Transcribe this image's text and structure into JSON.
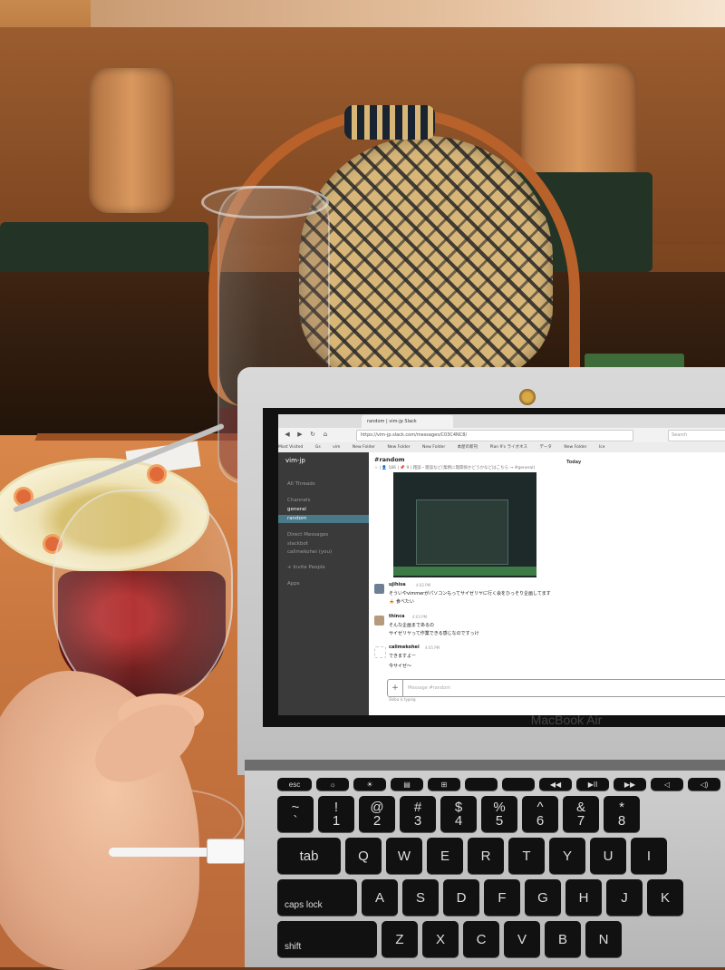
{
  "browser": {
    "tab_title": "random | vim-jp Slack",
    "url": "https://vim-jp.slack.com/messages/C03C4NC8/",
    "search_placeholder": "Search",
    "bookmarks": [
      "Most Visited",
      "Gs",
      "vim",
      "New Folder",
      "New Folder",
      "New Folder",
      "本屋の新刊",
      "Plan 9's ライオネス",
      "データ",
      "New Folder",
      "Ice"
    ]
  },
  "slack": {
    "team": "vim-jp",
    "sidebar": {
      "all_threads": "All Threads",
      "channels_label": "Channels",
      "channels": [
        "general",
        "random"
      ],
      "dm_label": "Direct Messages",
      "dms": [
        "slackbot",
        "calimekohei (you)"
      ],
      "invite": "+ Invite People",
      "apps": "Apps"
    },
    "channel": "#random",
    "topic": "☆ | 👤 186 | 📌 9 | 雑談・雑談など(業務に無関係かどうかなどはこちら → #general)",
    "date_divider": "Today",
    "messages": [
      {
        "user": "ujihisa",
        "time": "4:02 PM",
        "text": "そういやvimmerがパソコンもってサイゼリヤに行く会をひっそり企画してます",
        "extra": "🍝 食べたい"
      },
      {
        "user": "thinca",
        "time": "4:03 PM",
        "text": "そんな企画まであるの",
        "extra": "サイゼリヤって作業できる感じなのですっけ"
      },
      {
        "user": "calimekohei",
        "time": "4:05 PM",
        "text": "できますよー",
        "extra": "今サイゼ〜"
      }
    ],
    "composer_placeholder": "Message #random",
    "typing": "Shiba is typing"
  },
  "laptop": {
    "brand": "MacBook Air"
  },
  "keyboard": {
    "row1": [
      "esc",
      "☼",
      "☀",
      "▤",
      "⊞",
      "",
      "",
      "◀◀",
      "▶II",
      "▶▶",
      "◁",
      "◁)",
      "◁))"
    ],
    "row2": [
      "~\n`",
      "!\n1",
      "@\n2",
      "#\n3",
      "$\n4",
      "%\n5",
      "^\n6",
      "&\n7",
      "*\n8"
    ],
    "row3": [
      "tab",
      "Q",
      "W",
      "E",
      "R",
      "T",
      "Y",
      "U",
      "I"
    ],
    "row4": [
      "caps lock",
      "A",
      "S",
      "D",
      "F",
      "G",
      "H",
      "J",
      "K"
    ],
    "row5": [
      "shift",
      "Z",
      "X",
      "C",
      "V",
      "B",
      "N"
    ]
  }
}
